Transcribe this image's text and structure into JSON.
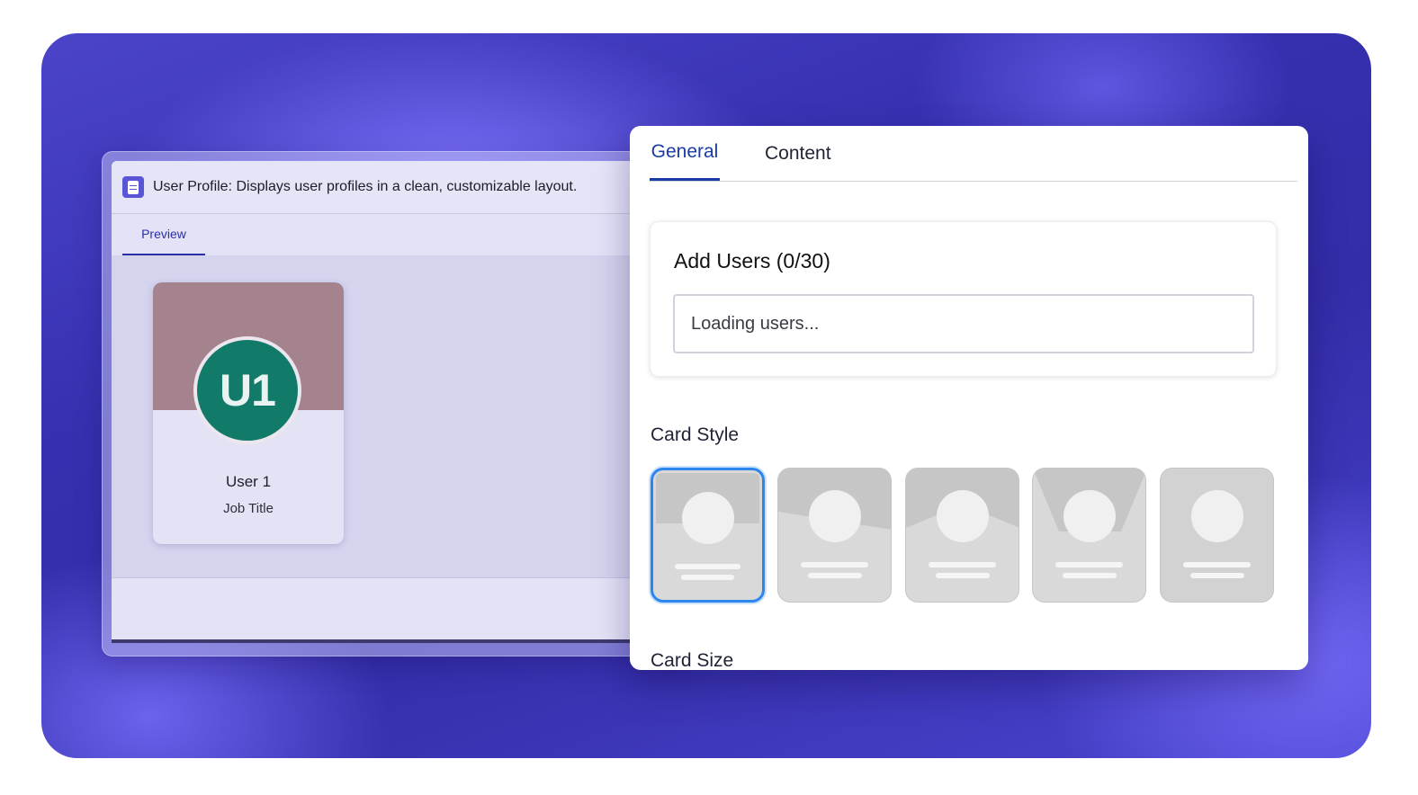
{
  "back_window": {
    "title": "User Profile: Displays user profiles in a clean, customizable layout.",
    "tab_preview": "Preview",
    "profile_card": {
      "initials": "U1",
      "name": "User 1",
      "job_title": "Job Title",
      "avatar_color": "#127a68",
      "banner_color": "#a4838f"
    }
  },
  "panel": {
    "tabs": [
      {
        "label": "General",
        "active": true
      },
      {
        "label": "Content",
        "active": false
      }
    ],
    "add_users": {
      "title": "Add Users (0/30)",
      "placeholder": "Loading users..."
    },
    "card_style": {
      "label": "Card Style",
      "options": [
        "style-1",
        "style-2",
        "style-3",
        "style-4",
        "style-5"
      ],
      "selected_index": 0
    },
    "card_size": {
      "label": "Card Size"
    },
    "accent_color": "#1a3ba6",
    "selected_outline_color": "#2d86ee"
  }
}
